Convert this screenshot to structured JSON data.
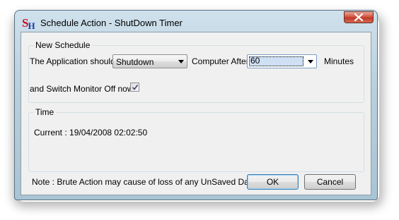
{
  "window": {
    "title": "Schedule Action - ShutDown Timer",
    "icon_letters": [
      "S",
      "H"
    ]
  },
  "new_schedule": {
    "group_label": "New Schedule",
    "app_should_label": "The Application should",
    "action_value": "Shutdown",
    "computer_after_label": "Computer After",
    "minutes_value": "60",
    "minutes_label": "Minutes",
    "monitor_off_label": "and Switch Monitor Off now",
    "monitor_off_checked": true
  },
  "time": {
    "group_label": "Time",
    "current_text": "Current : 19/04/2008 02:02:50"
  },
  "footer": {
    "note": "Note : Brute Action may cause of loss of any UnSaved Data",
    "ok_label": "OK",
    "cancel_label": "Cancel"
  },
  "colors": {
    "frame": "#b9d0de",
    "close_button": "#c0392b",
    "client": "#f0f0f0"
  }
}
